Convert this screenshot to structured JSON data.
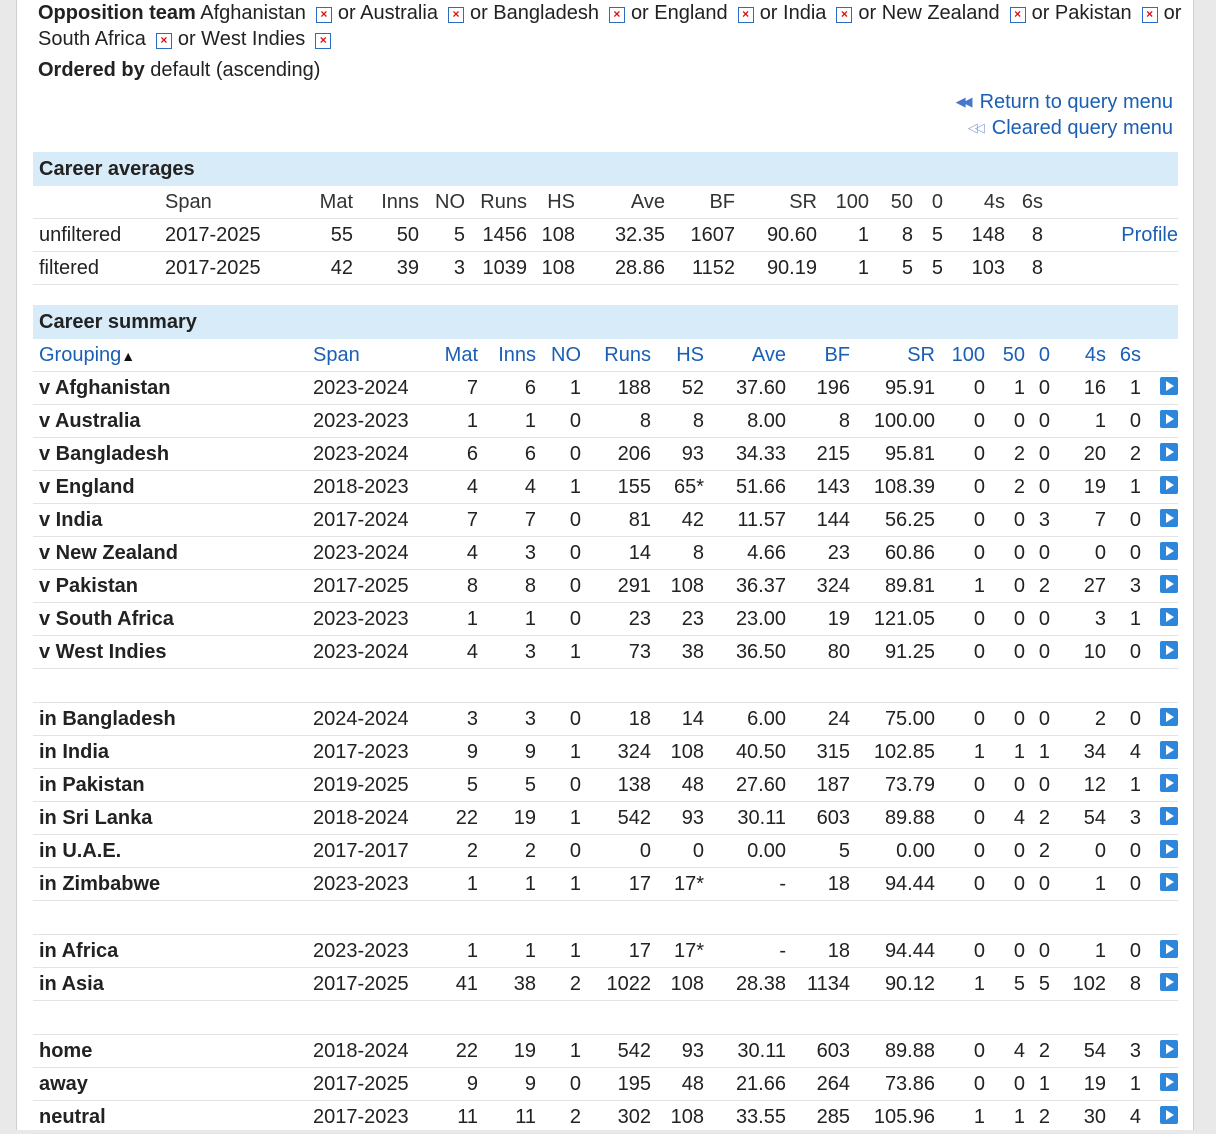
{
  "filters": {
    "opposition_label": "Opposition team",
    "teams": [
      "Afghanistan",
      "or Australia",
      "or Bangladesh",
      "or England",
      "or India",
      "or New Zealand",
      "or Pakistan",
      "or South Africa",
      "or West Indies"
    ],
    "ordered_label": "Ordered by",
    "ordered_value": "default (ascending)"
  },
  "links": {
    "return": "Return to query menu",
    "cleared": "Cleared query menu"
  },
  "career_averages": {
    "title": "Career averages",
    "headers": [
      "",
      "Span",
      "Mat",
      "Inns",
      "NO",
      "Runs",
      "HS",
      "Ave",
      "BF",
      "SR",
      "100",
      "50",
      "0",
      "4s",
      "6s",
      ""
    ],
    "rows": [
      [
        "unfiltered",
        "2017-2025",
        "55",
        "50",
        "5",
        "1456",
        "108",
        "32.35",
        "1607",
        "90.60",
        "1",
        "8",
        "5",
        "148",
        "8",
        "Profile"
      ],
      [
        "filtered",
        "2017-2025",
        "42",
        "39",
        "3",
        "1039",
        "108",
        "28.86",
        "1152",
        "90.19",
        "1",
        "5",
        "5",
        "103",
        "8",
        ""
      ]
    ]
  },
  "career_summary": {
    "title": "Career summary",
    "headers": [
      "Grouping",
      "Span",
      "Mat",
      "Inns",
      "NO",
      "Runs",
      "HS",
      "Ave",
      "BF",
      "SR",
      "100",
      "50",
      "0",
      "4s",
      "6s"
    ],
    "sort_arrow": "▲",
    "groups": [
      [
        [
          "v Afghanistan",
          "2023-2024",
          "7",
          "6",
          "1",
          "188",
          "52",
          "37.60",
          "196",
          "95.91",
          "0",
          "1",
          "0",
          "16",
          "1"
        ],
        [
          "v Australia",
          "2023-2023",
          "1",
          "1",
          "0",
          "8",
          "8",
          "8.00",
          "8",
          "100.00",
          "0",
          "0",
          "0",
          "1",
          "0"
        ],
        [
          "v Bangladesh",
          "2023-2024",
          "6",
          "6",
          "0",
          "206",
          "93",
          "34.33",
          "215",
          "95.81",
          "0",
          "2",
          "0",
          "20",
          "2"
        ],
        [
          "v England",
          "2018-2023",
          "4",
          "4",
          "1",
          "155",
          "65*",
          "51.66",
          "143",
          "108.39",
          "0",
          "2",
          "0",
          "19",
          "1"
        ],
        [
          "v India",
          "2017-2024",
          "7",
          "7",
          "0",
          "81",
          "42",
          "11.57",
          "144",
          "56.25",
          "0",
          "0",
          "3",
          "7",
          "0"
        ],
        [
          "v New Zealand",
          "2023-2024",
          "4",
          "3",
          "0",
          "14",
          "8",
          "4.66",
          "23",
          "60.86",
          "0",
          "0",
          "0",
          "0",
          "0"
        ],
        [
          "v Pakistan",
          "2017-2025",
          "8",
          "8",
          "0",
          "291",
          "108",
          "36.37",
          "324",
          "89.81",
          "1",
          "0",
          "2",
          "27",
          "3"
        ],
        [
          "v South Africa",
          "2023-2023",
          "1",
          "1",
          "0",
          "23",
          "23",
          "23.00",
          "19",
          "121.05",
          "0",
          "0",
          "0",
          "3",
          "1"
        ],
        [
          "v West Indies",
          "2023-2024",
          "4",
          "3",
          "1",
          "73",
          "38",
          "36.50",
          "80",
          "91.25",
          "0",
          "0",
          "0",
          "10",
          "0"
        ]
      ],
      [
        [
          "in Bangladesh",
          "2024-2024",
          "3",
          "3",
          "0",
          "18",
          "14",
          "6.00",
          "24",
          "75.00",
          "0",
          "0",
          "0",
          "2",
          "0"
        ],
        [
          "in India",
          "2017-2023",
          "9",
          "9",
          "1",
          "324",
          "108",
          "40.50",
          "315",
          "102.85",
          "1",
          "1",
          "1",
          "34",
          "4"
        ],
        [
          "in Pakistan",
          "2019-2025",
          "5",
          "5",
          "0",
          "138",
          "48",
          "27.60",
          "187",
          "73.79",
          "0",
          "0",
          "0",
          "12",
          "1"
        ],
        [
          "in Sri Lanka",
          "2018-2024",
          "22",
          "19",
          "1",
          "542",
          "93",
          "30.11",
          "603",
          "89.88",
          "0",
          "4",
          "2",
          "54",
          "3"
        ],
        [
          "in U.A.E.",
          "2017-2017",
          "2",
          "2",
          "0",
          "0",
          "0",
          "0.00",
          "5",
          "0.00",
          "0",
          "0",
          "2",
          "0",
          "0"
        ],
        [
          "in Zimbabwe",
          "2023-2023",
          "1",
          "1",
          "1",
          "17",
          "17*",
          "-",
          "18",
          "94.44",
          "0",
          "0",
          "0",
          "1",
          "0"
        ]
      ],
      [
        [
          "in Africa",
          "2023-2023",
          "1",
          "1",
          "1",
          "17",
          "17*",
          "-",
          "18",
          "94.44",
          "0",
          "0",
          "0",
          "1",
          "0"
        ],
        [
          "in Asia",
          "2017-2025",
          "41",
          "38",
          "2",
          "1022",
          "108",
          "28.38",
          "1134",
          "90.12",
          "1",
          "5",
          "5",
          "102",
          "8"
        ]
      ],
      [
        [
          "home",
          "2018-2024",
          "22",
          "19",
          "1",
          "542",
          "93",
          "30.11",
          "603",
          "89.88",
          "0",
          "4",
          "2",
          "54",
          "3"
        ],
        [
          "away",
          "2017-2025",
          "9",
          "9",
          "0",
          "195",
          "48",
          "21.66",
          "264",
          "73.86",
          "0",
          "0",
          "1",
          "19",
          "1"
        ],
        [
          "neutral",
          "2017-2023",
          "11",
          "11",
          "2",
          "302",
          "108",
          "33.55",
          "285",
          "105.96",
          "1",
          "1",
          "2",
          "30",
          "4"
        ]
      ]
    ]
  }
}
